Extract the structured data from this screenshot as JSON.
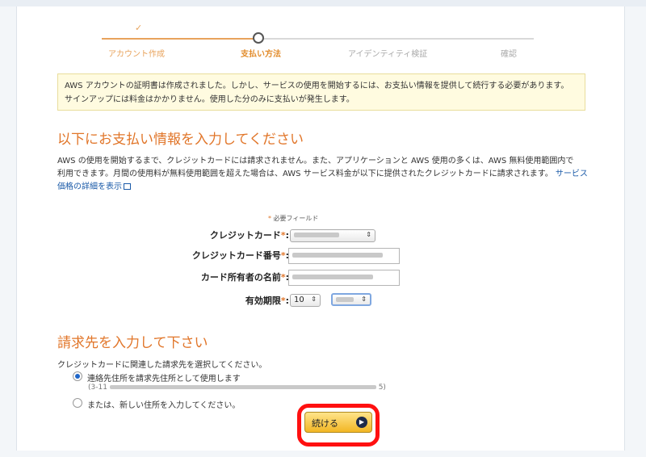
{
  "progress": {
    "steps": [
      {
        "label": "アカウント作成",
        "state": "done"
      },
      {
        "label": "支払い方法",
        "state": "active"
      },
      {
        "label": "アイデンティティ検証",
        "state": "pending"
      },
      {
        "label": "確認",
        "state": "pending"
      }
    ]
  },
  "notice": {
    "line1": "AWS アカウントの証明書は作成されました。しかし、サービスの使用を開始するには、お支払い情報を提供して続行する必要があります。",
    "line2": "サインアップには料金はかかりません。使用した分のみに支払いが発生します。"
  },
  "payment": {
    "heading": "以下にお支払い情報を入力してください",
    "intro_line1": "AWS の使用を開始するまで、クレジットカードには請求されません。また、アプリケーションと AWS 使用の多くは、AWS 無料使用範囲内で",
    "intro_line2": "利用できます。月間の使用料が無料使用範囲を超えた場合は、AWS サービス料金が以下に提供されたクレジットカードに請求されます。",
    "pricing_link": "サービス価格の詳細を表示",
    "required_note": "必要フィールド",
    "card_type_label": "クレジットカード",
    "card_number_label": "クレジットカード番号",
    "cardholder_label": "カード所有者の名前",
    "expiry_label": "有効期限",
    "expiry_month": "10"
  },
  "billing": {
    "heading": "請求先を入力して下さい",
    "prompt": "クレジットカードに関連した請求先を選択してください。",
    "option_contact": "連絡先住所を請求先住所として使用します",
    "address_prefix": "(3-11",
    "address_suffix": "5)",
    "option_new": "または、新しい住所を入力してください。"
  },
  "actions": {
    "continue_label": "続ける"
  },
  "colors": {
    "accent": "#e1762a",
    "link": "#1a5aa8",
    "highlight": "#ff1010"
  }
}
